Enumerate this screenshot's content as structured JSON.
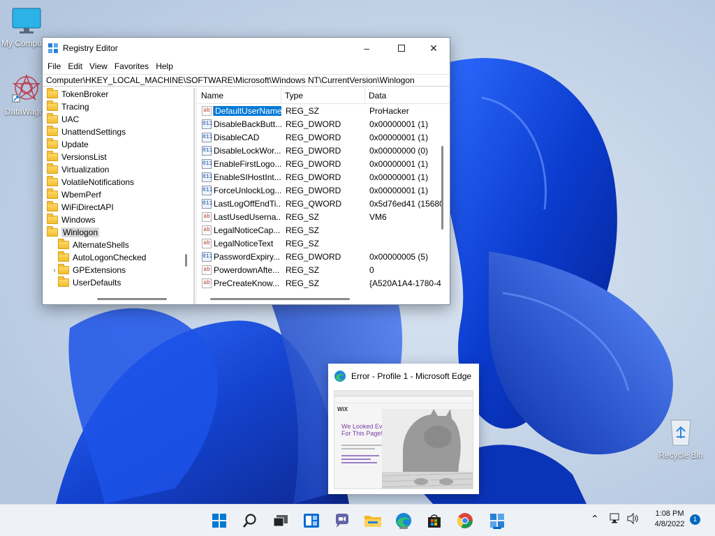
{
  "desktop": {
    "icons": [
      {
        "label": "My Computer"
      },
      {
        "label": "DataWagon"
      },
      {
        "label": "Recycle Bin"
      }
    ]
  },
  "regedit": {
    "title": "Registry Editor",
    "menu": [
      "File",
      "Edit",
      "View",
      "Favorites",
      "Help"
    ],
    "address": "Computer\\HKEY_LOCAL_MACHINE\\SOFTWARE\\Microsoft\\Windows NT\\CurrentVersion\\Winlogon",
    "tree": [
      {
        "label": "TokenBroker",
        "level": 0
      },
      {
        "label": "Tracing",
        "level": 0
      },
      {
        "label": "UAC",
        "level": 0
      },
      {
        "label": "UnattendSettings",
        "level": 0
      },
      {
        "label": "Update",
        "level": 0
      },
      {
        "label": "VersionsList",
        "level": 0
      },
      {
        "label": "Virtualization",
        "level": 0
      },
      {
        "label": "VolatileNotifications",
        "level": 0
      },
      {
        "label": "WbemPerf",
        "level": 0
      },
      {
        "label": "WiFiDirectAPI",
        "level": 0
      },
      {
        "label": "Windows",
        "level": 0
      },
      {
        "label": "Winlogon",
        "level": 0,
        "selected": true
      },
      {
        "label": "AlternateShells",
        "level": 1
      },
      {
        "label": "AutoLogonChecked",
        "level": 1
      },
      {
        "label": "GPExtensions",
        "level": 1,
        "expandable": true
      },
      {
        "label": "UserDefaults",
        "level": 1
      }
    ],
    "columns": [
      "Name",
      "Type",
      "Data"
    ],
    "values": [
      {
        "name": "DefaultUserName",
        "type": "REG_SZ",
        "data": "ProHacker",
        "kind": "sz",
        "selected": true
      },
      {
        "name": "DisableBackButt...",
        "type": "REG_DWORD",
        "data": "0x00000001 (1)",
        "kind": "dw"
      },
      {
        "name": "DisableCAD",
        "type": "REG_DWORD",
        "data": "0x00000001 (1)",
        "kind": "dw"
      },
      {
        "name": "DisableLockWor...",
        "type": "REG_DWORD",
        "data": "0x00000000 (0)",
        "kind": "dw"
      },
      {
        "name": "EnableFirstLogo...",
        "type": "REG_DWORD",
        "data": "0x00000001 (1)",
        "kind": "dw"
      },
      {
        "name": "EnableSIHostInt...",
        "type": "REG_DWORD",
        "data": "0x00000001 (1)",
        "kind": "dw"
      },
      {
        "name": "ForceUnlockLog...",
        "type": "REG_DWORD",
        "data": "0x00000001 (1)",
        "kind": "dw"
      },
      {
        "name": "LastLogOffEndTi...",
        "type": "REG_QWORD",
        "data": "0x5d76ed41 (15680",
        "kind": "dw"
      },
      {
        "name": "LastUsedUserna...",
        "type": "REG_SZ",
        "data": "VM6",
        "kind": "sz"
      },
      {
        "name": "LegalNoticeCap...",
        "type": "REG_SZ",
        "data": "",
        "kind": "sz"
      },
      {
        "name": "LegalNoticeText",
        "type": "REG_SZ",
        "data": "",
        "kind": "sz"
      },
      {
        "name": "PasswordExpiry...",
        "type": "REG_DWORD",
        "data": "0x00000005 (5)",
        "kind": "dw"
      },
      {
        "name": "PowerdownAfte...",
        "type": "REG_SZ",
        "data": "0",
        "kind": "sz"
      },
      {
        "name": "PreCreateKnow...",
        "type": "REG_SZ",
        "data": "{A520A1A4-1780-4",
        "kind": "sz"
      }
    ]
  },
  "edge_preview": {
    "title": "Error - Profile 1 - Microsoft Edge",
    "heading": "We Looked Everywhere For This Page!",
    "brand": "WiX"
  },
  "taskbar": {
    "icons": [
      "start-icon",
      "search-icon",
      "task-view-icon",
      "widgets-icon",
      "chat-icon",
      "file-explorer-icon",
      "edge-icon",
      "store-icon",
      "chrome-icon",
      "regedit-icon"
    ],
    "time": "1:08 PM",
    "date": "4/8/2022",
    "notification_count": "1"
  }
}
